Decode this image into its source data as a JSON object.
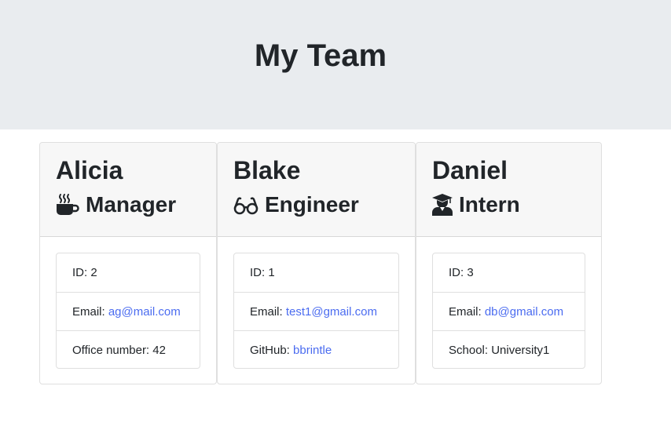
{
  "header": {
    "title": "My Team"
  },
  "colors": {
    "link": "#4b6cf0",
    "jumbotron_bg": "#e9ecef",
    "card_header_bg": "#f7f7f7"
  },
  "cards": [
    {
      "name": "Alicia",
      "role": "Manager",
      "role_icon": "coffee-mug-icon",
      "id_label": "ID: 2",
      "email_label": "Email: ",
      "email": "ag@mail.com",
      "extra_label": "Office number: 42"
    },
    {
      "name": "Blake",
      "role": "Engineer",
      "role_icon": "glasses-icon",
      "id_label": "ID: 1",
      "email_label": "Email: ",
      "email": "test1@gmail.com",
      "extra_prefix": "GitHub: ",
      "github": "bbrintle"
    },
    {
      "name": "Daniel",
      "role": "Intern",
      "role_icon": "graduate-icon",
      "id_label": "ID: 3",
      "email_label": "Email: ",
      "email": "db@gmail.com",
      "extra_label": "School: University1"
    }
  ]
}
